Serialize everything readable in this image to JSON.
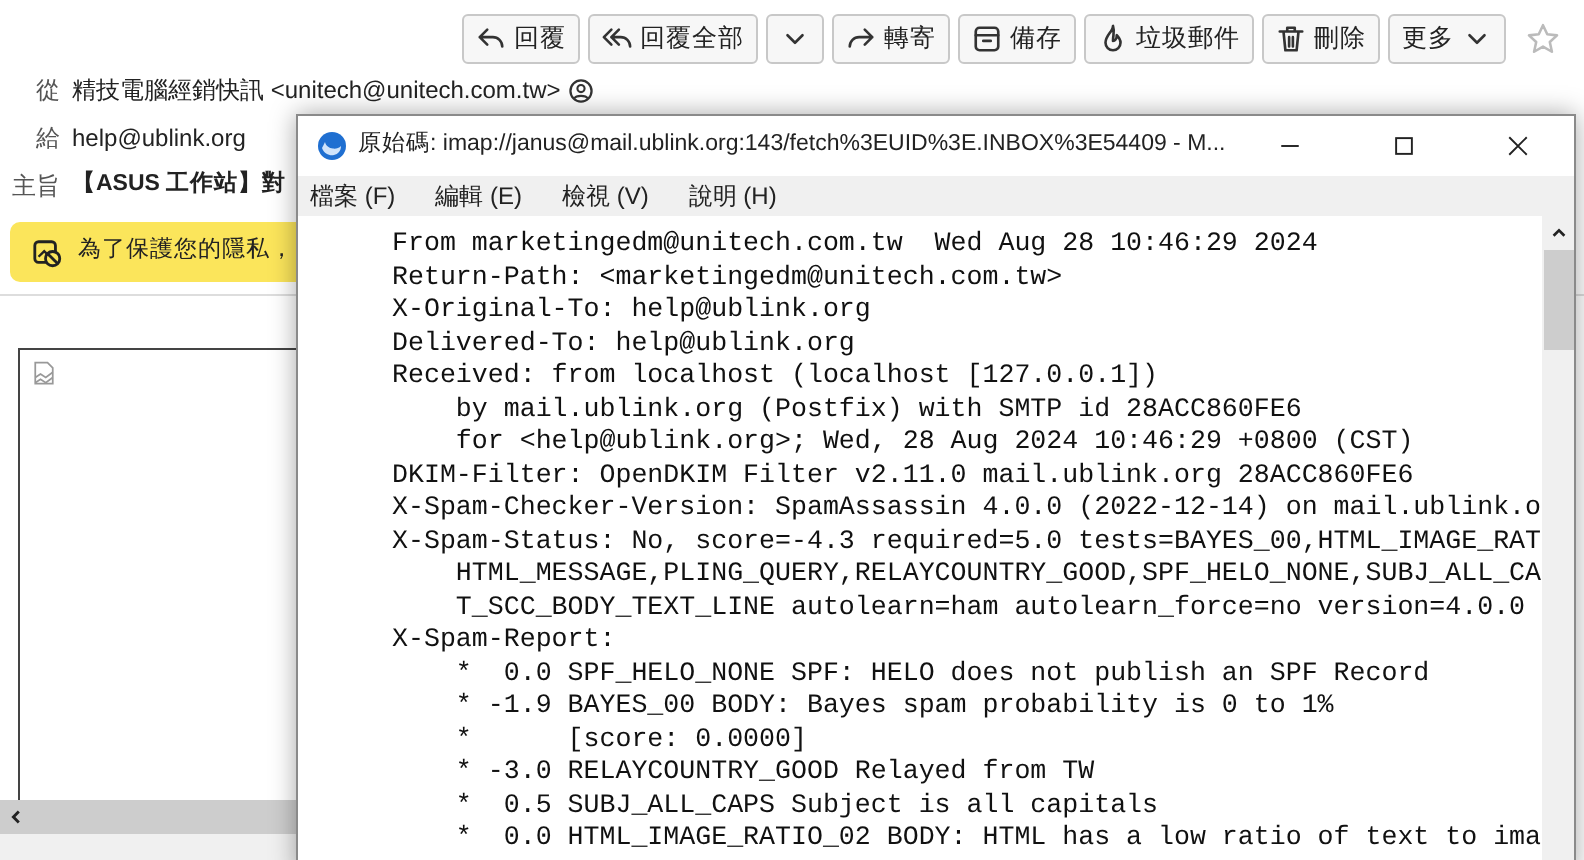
{
  "toolbar": {
    "buttons": [
      {
        "kind": "icon-label",
        "label": "回覆"
      },
      {
        "kind": "icon-label",
        "label": "回覆全部"
      },
      {
        "kind": "caret"
      },
      {
        "kind": "icon-label",
        "label": "轉寄"
      },
      {
        "kind": "icon-label",
        "label": "備存"
      },
      {
        "kind": "icon-label",
        "label": "垃圾郵件"
      },
      {
        "kind": "icon-label",
        "label": "刪除"
      },
      {
        "kind": "label-caret",
        "label": "更多"
      }
    ],
    "starred": false
  },
  "headers": [
    {
      "kind": "address",
      "label": "從",
      "value": "精技電腦經銷快訊 <unitech@unitech.com.tw>"
    },
    {
      "kind": "recipient",
      "label": "給",
      "value": "help@ublink.org"
    },
    {
      "kind": "subject",
      "label": "主旨",
      "value": "【ASUS 工作站】對"
    }
  ],
  "notice": {
    "text": "為了保護您的隱私，"
  },
  "source_window": {
    "title": "原始碼: imap://janus@mail.ublink.org:143/fetch%3EUID%3E.INBOX%3E54409 - M...",
    "menu": [
      "檔案 (F)",
      "編輯 (E)",
      "檢視 (V)",
      "說明 (H)"
    ],
    "lines": [
      "From marketingedm@unitech.com.tw  Wed Aug 28 10:46:29 2024",
      "Return-Path: <marketingedm@unitech.com.tw>",
      "X-Original-To: help@ublink.org",
      "Delivered-To: help@ublink.org",
      "Received: from localhost (localhost [127.0.0.1])",
      "    by mail.ublink.org (Postfix) with SMTP id 28ACC860FE6",
      "    for <help@ublink.org>; Wed, 28 Aug 2024 10:46:29 +0800 (CST)",
      "DKIM-Filter: OpenDKIM Filter v2.11.0 mail.ublink.org 28ACC860FE6",
      "X-Spam-Checker-Version: SpamAssassin 4.0.0 (2022-12-14) on mail.ublink.o",
      "X-Spam-Status: No, score=-4.3 required=5.0 tests=BAYES_00,HTML_IMAGE_RAT",
      "    HTML_MESSAGE,PLING_QUERY,RELAYCOUNTRY_GOOD,SPF_HELO_NONE,SUBJ_ALL_CA",
      "    T_SCC_BODY_TEXT_LINE autolearn=ham autolearn_force=no version=4.0.0",
      "X-Spam-Report:",
      "    *  0.0 SPF_HELO_NONE SPF: HELO does not publish an SPF Record",
      "    * -1.9 BAYES_00 BODY: Bayes spam probability is 0 to 1%",
      "    *      [score: 0.0000]",
      "    * -3.0 RELAYCOUNTRY_GOOD Relayed from TW",
      "    *  0.5 SUBJ_ALL_CAPS Subject is all capitals",
      "    *  0.0 HTML_IMAGE_RATIO_02 BODY: HTML has a low ratio of text to ima"
    ]
  }
}
